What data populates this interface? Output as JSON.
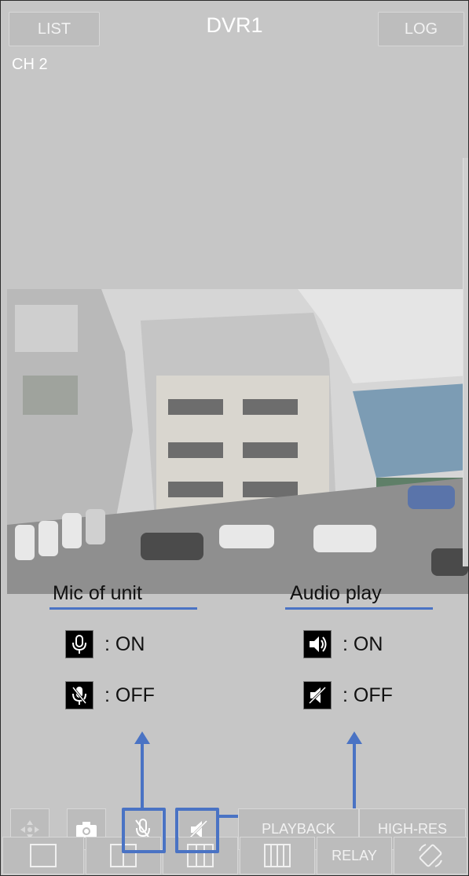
{
  "header": {
    "list_label": "LIST",
    "title": "DVR1",
    "log_label": "LOG"
  },
  "channel_label": "CH 2",
  "annotations": {
    "mic": {
      "title": "Mic of unit",
      "on_label": ": ON",
      "off_label": ": OFF"
    },
    "audio": {
      "title": "Audio play",
      "on_label": ": ON",
      "off_label": ": OFF"
    }
  },
  "toolbar": {
    "playback_label": "PLAYBACK",
    "highres_label": "HIGH-RES",
    "relay_label": "RELAY"
  },
  "colors": {
    "accent": "#4a73c4",
    "ui_gray": "#bcbcbc"
  }
}
